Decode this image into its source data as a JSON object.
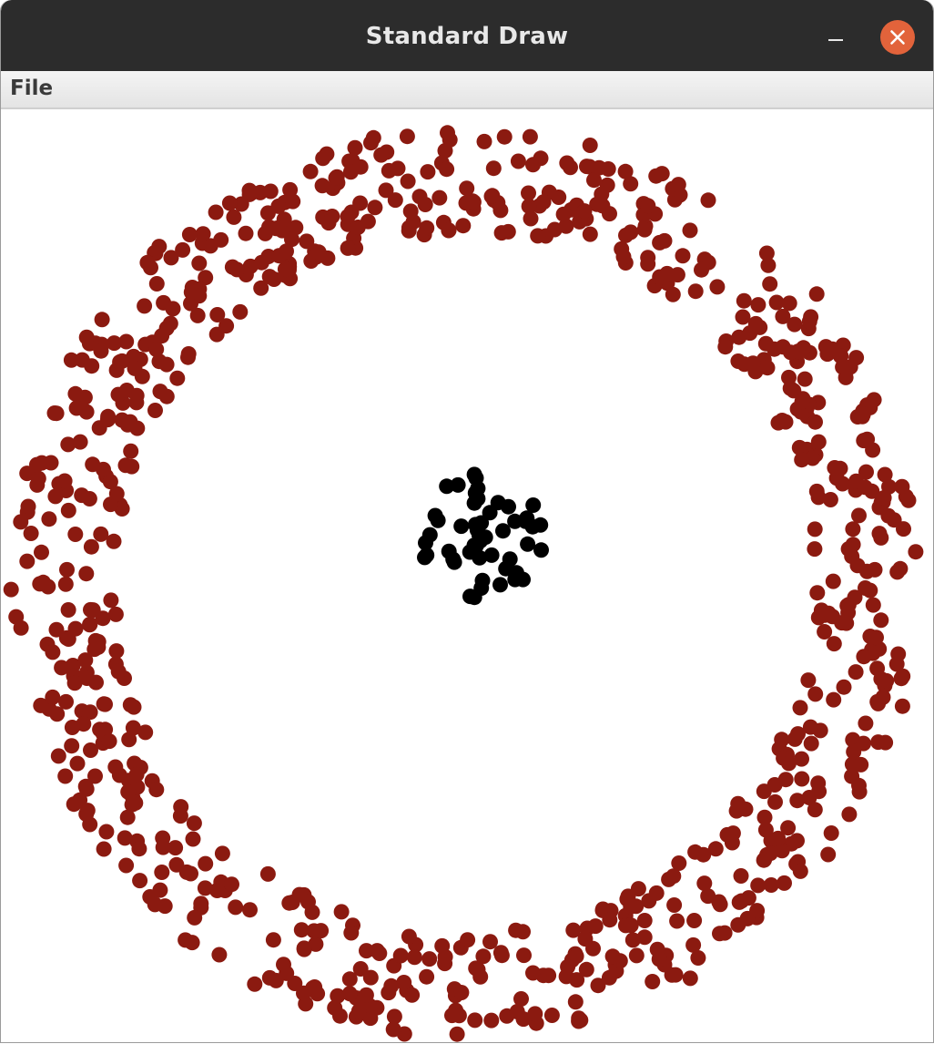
{
  "window": {
    "title": "Standard Draw"
  },
  "menu": {
    "file_label": "File"
  },
  "colors": {
    "titlebar": "#2c2c2c",
    "close_button": "#e2633b",
    "ring_points": "#8b1a10",
    "center_points": "#000000"
  },
  "icons": {
    "minimize": "minimize-icon",
    "close": "close-icon"
  }
}
